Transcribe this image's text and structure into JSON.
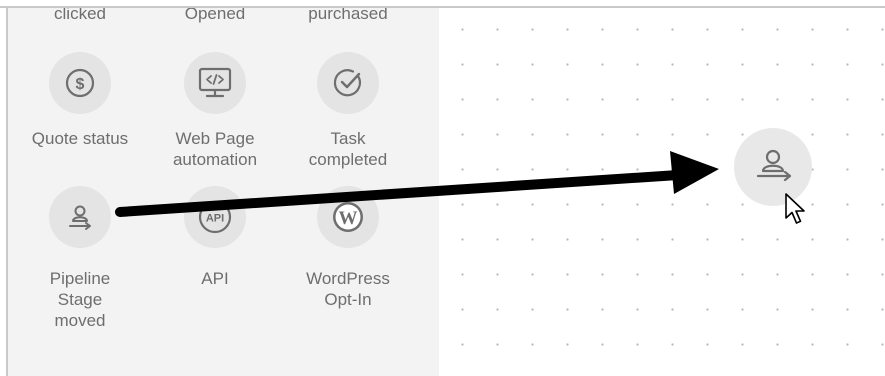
{
  "palette": {
    "top_row_labels": [
      "clicked",
      "Opened",
      "purchased"
    ],
    "items": [
      {
        "label_lines": [
          "Quote status"
        ],
        "icon": "dollar-coin-icon"
      },
      {
        "label_lines": [
          "Web Page",
          "automation"
        ],
        "icon": "web-page-code-icon"
      },
      {
        "label_lines": [
          "Task",
          "completed"
        ],
        "icon": "task-check-icon"
      },
      {
        "label_lines": [
          "Pipeline",
          "Stage",
          "moved"
        ],
        "icon": "pipeline-stage-icon"
      },
      {
        "label_lines": [
          "API"
        ],
        "icon": "api-icon",
        "icon_text": "API"
      },
      {
        "label_lines": [
          "WordPress",
          "Opt-In"
        ],
        "icon": "wordpress-icon",
        "icon_text": "W"
      }
    ]
  },
  "canvas": {
    "dropped_node_icon": "pipeline-stage-icon",
    "cursor_icon": "mouse-pointer-icon",
    "drag_arrow": "drag-arrow"
  },
  "colors": {
    "panel_bg": "#f3f3f3",
    "icon_circle_bg": "#e4e4e4",
    "icon_stroke": "#6e6e6e",
    "text": "#6e6e6e",
    "arrow": "#000000"
  }
}
